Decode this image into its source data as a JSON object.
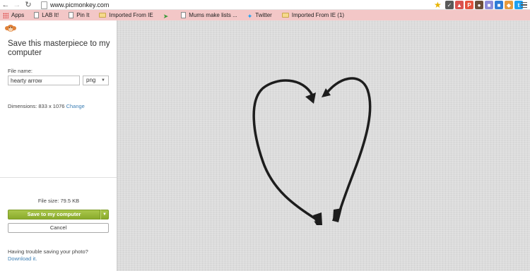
{
  "browser": {
    "url": "www.picmonkey.com",
    "back_icon": "back-arrow-icon",
    "forward_icon": "forward-arrow-icon",
    "reload_icon": "reload-icon",
    "bookmarks": [
      {
        "label": "Apps",
        "icon": "apps-grid-icon"
      },
      {
        "label": "LAB It!",
        "icon": "page-icon"
      },
      {
        "label": "Pin It",
        "icon": "page-icon"
      },
      {
        "label": "Imported From IE",
        "icon": "folder-icon"
      },
      {
        "label": "",
        "icon": "leaf-icon"
      },
      {
        "label": "Mums make lists ...",
        "icon": "page-icon"
      },
      {
        "label": "Twitter",
        "icon": "twitter-bird-icon"
      },
      {
        "label": "Imported From IE (1)",
        "icon": "folder-icon"
      }
    ]
  },
  "panel": {
    "title": "Save this masterpiece to my computer",
    "file_name_label": "File name:",
    "file_name_value": "hearty arrow",
    "format_value": "png",
    "dimensions_label": "Dimensions:",
    "dimensions_value": "833 x 1076",
    "change_link": "Change",
    "file_size": "File size: 79.5 KB",
    "save_button": "Save to my computer",
    "cancel_button": "Cancel",
    "trouble_text": "Having trouble saving your photo?",
    "download_link": "Download it."
  },
  "colors": {
    "bookmark_bar": "#f3c7c7",
    "save_button": "#9dba3c",
    "link": "#3d7fb5",
    "canvas_bg": "#dcdcdc"
  }
}
